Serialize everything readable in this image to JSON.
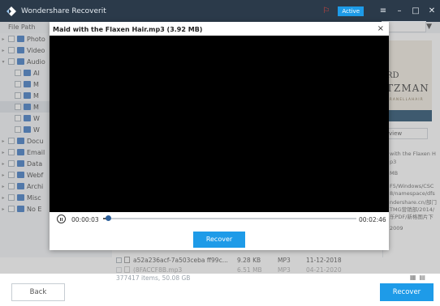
{
  "app": {
    "title": "Wondershare Recoverit",
    "active_badge": "Active",
    "accent": "#1e9be8"
  },
  "header": {
    "file_path_label": "File Path"
  },
  "sidebar": {
    "items": [
      {
        "label": "Photo"
      },
      {
        "label": "Video"
      },
      {
        "label": "Audio"
      },
      {
        "label": "AI"
      },
      {
        "label": "M"
      },
      {
        "label": "M"
      },
      {
        "label": "M"
      },
      {
        "label": "W"
      },
      {
        "label": "W"
      },
      {
        "label": "Docu"
      },
      {
        "label": "Email"
      },
      {
        "label": "Data"
      },
      {
        "label": "Webf"
      },
      {
        "label": "Archi"
      },
      {
        "label": "Misc"
      },
      {
        "label": "No E"
      }
    ]
  },
  "file_list": {
    "rows": [
      {
        "name": "a52a236acf-7a503ceba ff99c...",
        "size": "9.28 KB",
        "type": "MP3",
        "date": "11-12-2018"
      },
      {
        "name": "(8FACCF8B.mp3",
        "size": "6.51 MB",
        "type": "MP3",
        "date": "04-21-2020"
      }
    ],
    "status": "377417 items, 50.08 GB"
  },
  "preview": {
    "book_line1": "RD",
    "book_line2": "TZMAN",
    "book_line3": "R  A N E L L A  H A I R",
    "button_label": "view",
    "info_lines": [
      "with the Flaxen H",
      "p3",
      "MB",
      "F5/Windows/CSC",
      "8/namespace/dfs",
      "ndershare.cn/部门",
      "TMG营销部/2014/",
      "乐PDF/新格图片下",
      "2009"
    ]
  },
  "footer": {
    "back_label": "Back",
    "recover_label": "Recover"
  },
  "modal": {
    "title": "Maid with the Flaxen Hair.mp3 (3.92 MB)",
    "close_glyph": "×",
    "current_time": "00:00:03",
    "total_time": "00:02:46",
    "progress": 0.018,
    "recover_label": "Recover"
  }
}
